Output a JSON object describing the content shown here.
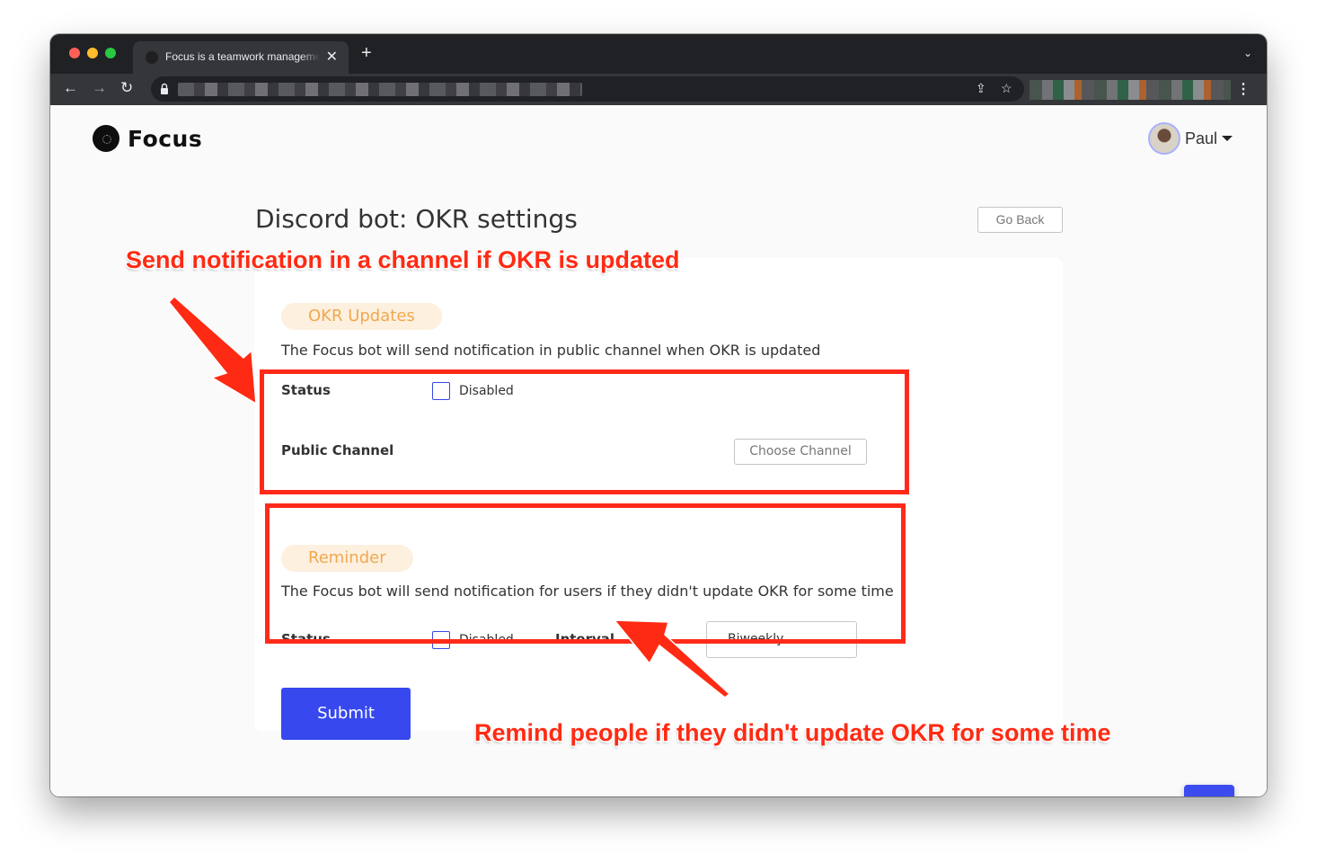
{
  "browser": {
    "tab_title": "Focus is a teamwork management",
    "tab_close_glyph": "✕",
    "new_tab_glyph": "+",
    "tab_menu_glyph": "⌄",
    "back_glyph": "←",
    "forward_glyph": "→",
    "reload_glyph": "↻",
    "share_glyph": "⇪",
    "star_glyph": "☆",
    "menu_glyph": "⋮"
  },
  "header": {
    "brand_name": "Focus",
    "user_name": "Paul"
  },
  "page": {
    "title": "Discord bot: OKR settings",
    "go_back_label": "Go Back"
  },
  "okr_updates": {
    "pill_label": "OKR Updates",
    "description": "The Focus bot will send notification in public channel when OKR is updated",
    "status_label": "Status",
    "checkbox_label": "Disabled",
    "checked": false,
    "channel_label": "Public Channel",
    "choose_channel_label": "Choose Channel"
  },
  "reminder": {
    "pill_label": "Reminder",
    "description": "The Focus bot will send notification for users if they didn't update OKR for some time",
    "status_label": "Status",
    "checkbox_label": "Disabled",
    "checked": false,
    "interval_label": "Interval",
    "interval_value": "Biweekly"
  },
  "form": {
    "submit_label": "Submit"
  },
  "annotations": {
    "top": "Send notification in a channel if OKR is updated",
    "bottom": "Remind people if they didn't update OKR for some time",
    "color": "#ff2a13"
  },
  "colors": {
    "accent": "#3748ef",
    "pill_bg": "#fdf0df",
    "pill_text": "#f2a84f"
  }
}
